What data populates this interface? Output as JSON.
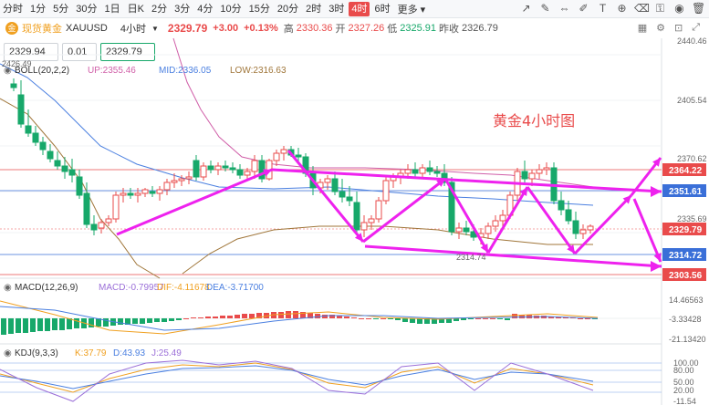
{
  "toolbar": {
    "timeframes": [
      "分时",
      "1分",
      "5分",
      "30分",
      "1日",
      "日K",
      "2分",
      "3分",
      "4分",
      "10分",
      "15分",
      "20分",
      "2时",
      "3时",
      "4时",
      "6时"
    ],
    "active_index": 14,
    "more_label": "更多",
    "tool_icons": [
      "trend-line-icon",
      "pen-icon",
      "measure-icon",
      "brush-icon",
      "text-icon",
      "magnet-icon",
      "eraser-icon",
      "lock-icon",
      "eye-icon",
      "delete-icon"
    ]
  },
  "quote": {
    "name": "现货黄金",
    "symbol": "XAUUSD",
    "interval": "4小时",
    "price": "2329.79",
    "change": "+3.00",
    "change_pct": "+0.13%",
    "high_label": "高",
    "high": "2330.36",
    "open_label": "开",
    "open": "2327.26",
    "low_label": "低",
    "low": "2325.91",
    "prev_label": "昨收",
    "prev": "2326.79"
  },
  "order": {
    "sell": "2329.94",
    "qty": "0.01",
    "buy": "2329.79"
  },
  "overlay_title": "黄金4小时图",
  "boll": {
    "label": "BOLL(20,2,2)",
    "up": "UP:2355.46",
    "mid": "MID:2336.05",
    "low": "LOW:2316.63"
  },
  "macd": {
    "label": "MACD(12,26,9)",
    "macd": "MACD:-0.79957",
    "dif": "DIF:-4.11678",
    "dea": "DEA:-3.71700"
  },
  "kdj": {
    "label": "KDJ(9,3,3)",
    "k": "K:37.79",
    "d": "D:43.93",
    "j": "J:25.49"
  },
  "price_axis": [
    "2440.46",
    "2405.54",
    "2370.62",
    "2335.69"
  ],
  "price_tags": [
    {
      "value": "2364.22",
      "color": "#e94b4b"
    },
    {
      "value": "2351.61",
      "color": "#3a6fd8"
    },
    {
      "value": "2329.79",
      "color": "#e94b4b"
    },
    {
      "value": "2314.72",
      "color": "#3a6fd8"
    },
    {
      "value": "2303.56",
      "color": "#e94b4b"
    }
  ],
  "annotations": {
    "high_mark": "2426.49",
    "low_mark": "2314.74"
  },
  "macd_axis": [
    "14.46563",
    "-3.33428",
    "-21.13420"
  ],
  "kdj_axis": [
    "100.00",
    "80.00",
    "50.00",
    "20.00",
    "-11.54"
  ],
  "colors": {
    "up": "#e94b4b",
    "down": "#17a86a",
    "arrow": "#ee22ee"
  }
}
